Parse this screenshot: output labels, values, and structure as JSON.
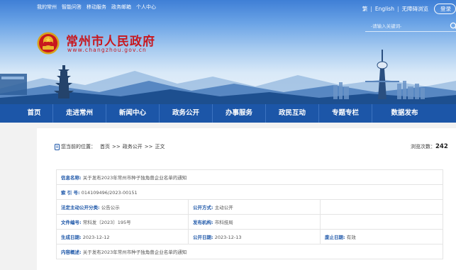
{
  "topbar": {
    "links": [
      "我的常州",
      "智能问答",
      "移动服务",
      "政务邮箱",
      "个人中心"
    ],
    "traditional": "繁",
    "english": "English",
    "accessibility": "无障碍浏览",
    "login": "登录"
  },
  "search": {
    "placeholder": "-请输入关键词-"
  },
  "site": {
    "name": "常州市人民政府",
    "domain": "www.changzhou.gov.cn"
  },
  "nav": [
    "首页",
    "走进常州",
    "新闻中心",
    "政务公开",
    "办事服务",
    "政民互动",
    "专题专栏",
    "数据发布"
  ],
  "breadcrumb": {
    "prefix": "您当前的位置：",
    "items": [
      "首页",
      "政务公开",
      "正文"
    ],
    "separator": ">>"
  },
  "views": {
    "label": "浏览次数：",
    "count": "242"
  },
  "info": {
    "title_label": "信息名称:",
    "title_value": "关于发布2023年常州市种子独角兽企业名单的通知",
    "index_label": "索 引 号:",
    "index_value": "014109496/2023-00151",
    "category_label": "法定主动公开分类:",
    "category_value": "公告公示",
    "method_label": "公开方式:",
    "method_value": "主动公开",
    "docno_label": "文件编号:",
    "docno_value": "常科发〔2023〕195号",
    "agency_label": "发布机构:",
    "agency_value": "市科技局",
    "created_label": "生成日期:",
    "created_value": "2023-12-12",
    "published_label": "公开日期:",
    "published_value": "2023-12-13",
    "expiry_label": "废止日期:",
    "expiry_value": "有效",
    "summary_label": "内容概述:",
    "summary_value": "关于发布2023年常州市种子独角兽企业名单的通知"
  },
  "colors": {
    "brand_red": "#c8171e",
    "nav_blue": "#1c56a8"
  }
}
